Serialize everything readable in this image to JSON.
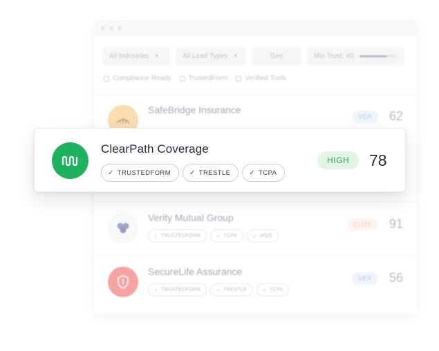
{
  "filters": {
    "industries": "All Industries",
    "lead_types": "All Lead Types",
    "geo": "Geo",
    "min_trust": "Min Trust: 40",
    "min_trust_value": 40
  },
  "checkboxes": [
    "Compliance Ready",
    "TrustedForm",
    "Verified Tools"
  ],
  "rows": [
    {
      "name": "SafeBridge Insurance",
      "badge": "VER",
      "score": "62"
    },
    {
      "name": "Verity Mutual Group",
      "badge": "ELITE",
      "score": "91",
      "chips": [
        "TRUSTEDFORM",
        "TCPA",
        "IPQS"
      ]
    },
    {
      "name": "SecureLife Assurance",
      "badge": "VER",
      "score": "56",
      "chips": [
        "TRUSTEDFORM",
        "TRESTLE",
        "TCPA"
      ]
    }
  ],
  "featured": {
    "name": "ClearPath Coverage",
    "chips": [
      "TRUSTEDFORM",
      "TRESTLE",
      "TCPA"
    ],
    "badge": "HIGH",
    "score": "78"
  },
  "icons": {
    "check": "check-icon",
    "caret": "chevron-down-icon",
    "featured_logo": "wave-logo-icon"
  },
  "colors": {
    "featured_logo": "#1eb25f",
    "high_badge_bg": "#e3f5e6",
    "high_badge_text": "#2f9a4e",
    "safebridge_logo": "#f6c77f",
    "securelife_logo": "#f06b6b",
    "verity_logo": "#6a6ea8"
  }
}
